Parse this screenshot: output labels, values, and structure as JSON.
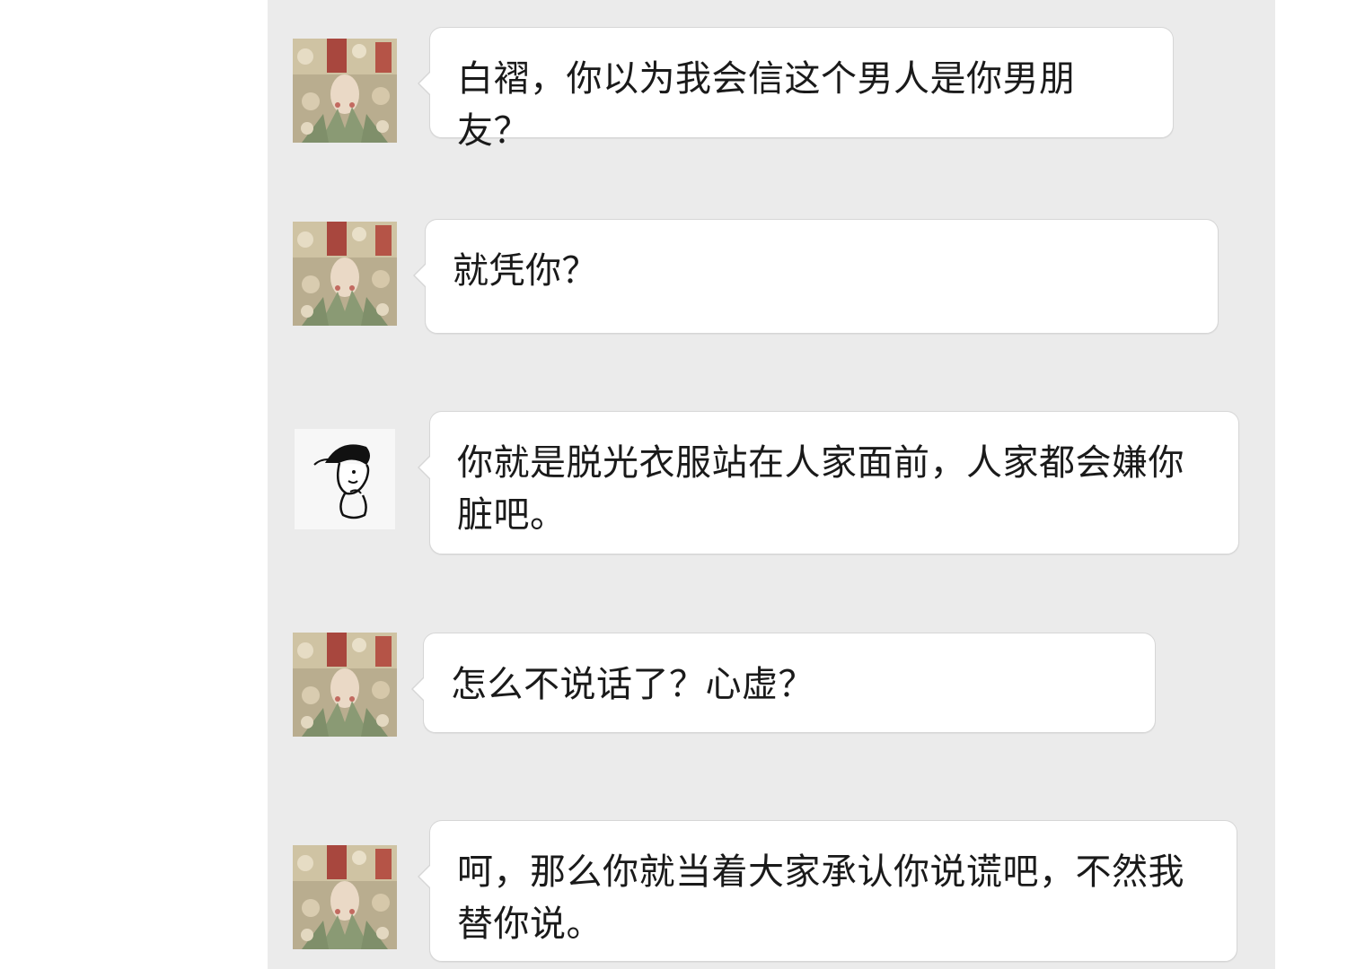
{
  "chat": {
    "messages": [
      {
        "sender": "floral-avatar",
        "text": "白褶，你以为我会信这个男人是你男朋友？"
      },
      {
        "sender": "floral-avatar",
        "text": "就凭你？"
      },
      {
        "sender": "cartoon-avatar",
        "text": "你就是脱光衣服站在人家面前，人家都会嫌你脏吧。"
      },
      {
        "sender": "floral-avatar",
        "text": "怎么不说话了？心虚？"
      },
      {
        "sender": "floral-avatar",
        "text": "呵，那么你就当着大家承认你说谎吧，不然我替你说。"
      }
    ]
  },
  "colors": {
    "panel_background": "#ebebeb",
    "bubble_background": "#ffffff",
    "text": "#1a1a1a"
  }
}
